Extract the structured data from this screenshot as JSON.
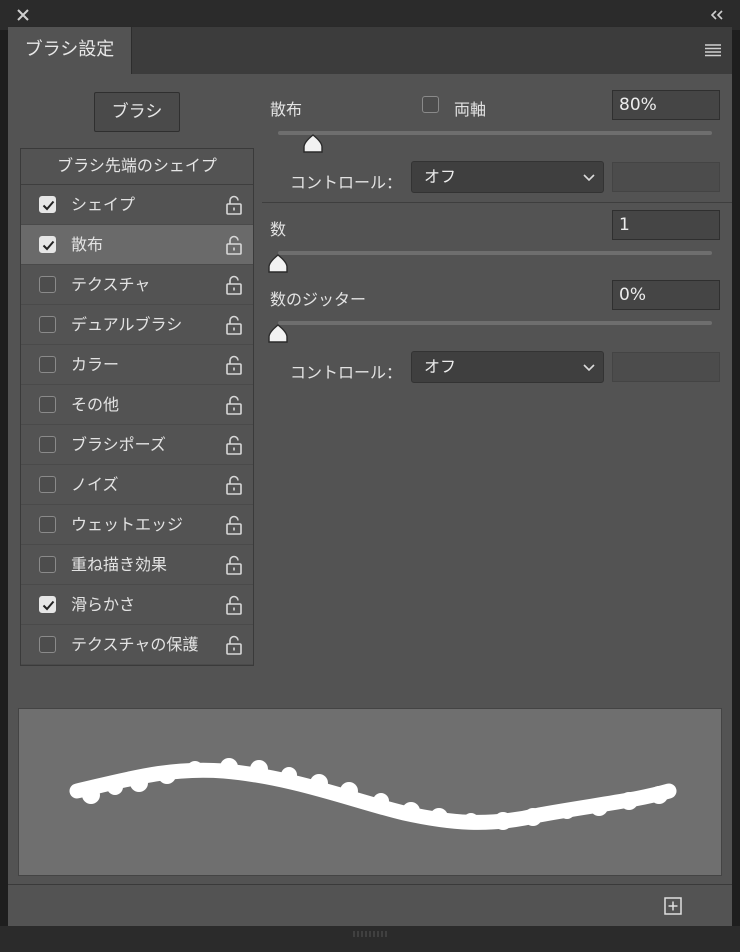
{
  "window": {
    "close_icon": "close-icon",
    "collapse_icon": "double-chevron-left-icon"
  },
  "tab": {
    "title": "ブラシ設定",
    "menu_icon": "panel-menu-icon"
  },
  "brush_button": {
    "label": "ブラシ"
  },
  "list": {
    "header": "ブラシ先端のシェイプ",
    "items": [
      {
        "label": "シェイプ",
        "checked": true,
        "selected": false
      },
      {
        "label": "散布",
        "checked": true,
        "selected": true
      },
      {
        "label": "テクスチャ",
        "checked": false,
        "selected": false
      },
      {
        "label": "デュアルブラシ",
        "checked": false,
        "selected": false
      },
      {
        "label": "カラー",
        "checked": false,
        "selected": false
      },
      {
        "label": "その他",
        "checked": false,
        "selected": false
      },
      {
        "label": "ブラシポーズ",
        "checked": false,
        "selected": false
      },
      {
        "label": "ノイズ",
        "checked": false,
        "selected": false
      },
      {
        "label": "ウェットエッジ",
        "checked": false,
        "selected": false
      },
      {
        "label": "重ね描き効果",
        "checked": false,
        "selected": false
      },
      {
        "label": "滑らかさ",
        "checked": true,
        "selected": false
      },
      {
        "label": "テクスチャの保護",
        "checked": false,
        "selected": false
      }
    ]
  },
  "scatter": {
    "label": "散布",
    "both_axes_label": "両軸",
    "both_axes_checked": false,
    "value": "80%",
    "slider_fraction": 0.08,
    "control_label": "コントロール：",
    "control_value": "オフ"
  },
  "count": {
    "label": "数",
    "value": "1",
    "slider_fraction": 0.0
  },
  "count_jitter": {
    "label": "数のジッター",
    "value": "0%",
    "slider_fraction": 0.0,
    "control_label": "コントロール：",
    "control_value": "オフ"
  },
  "footer": {
    "new_brush_icon": "new-brush-preset-icon"
  }
}
